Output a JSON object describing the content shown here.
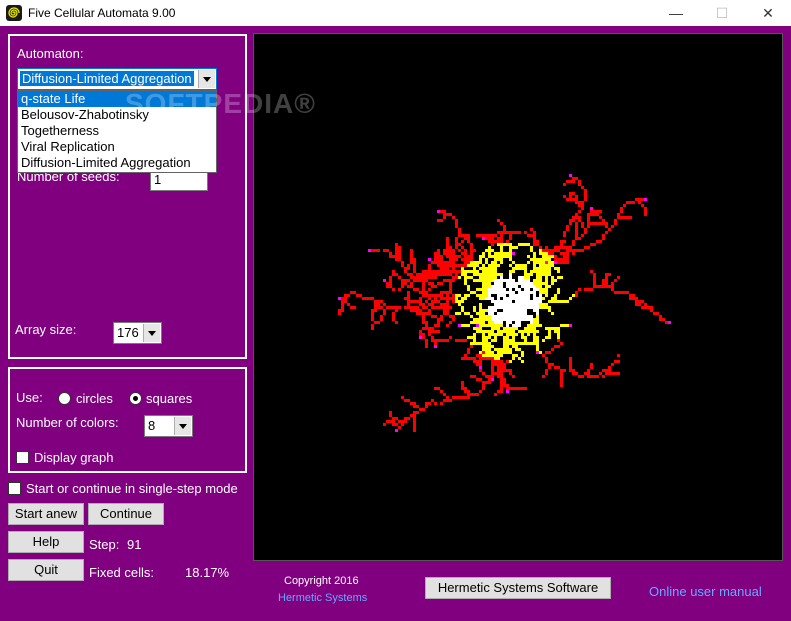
{
  "window": {
    "title": "Five Cellular Automata 9.00",
    "minimize": "—",
    "maximize": "☐",
    "close": "✕"
  },
  "watermark": "SOFTPEDIA®",
  "automaton": {
    "label": "Automaton:",
    "selected": "Diffusion-Limited Aggregation",
    "options": [
      "q-state Life",
      "Belousov-Zhabotinsky",
      "Togetherness",
      "Viral Replication",
      "Diffusion-Limited Aggregation"
    ],
    "highlighted": "q-state Life"
  },
  "seeds": {
    "label": "Number of seeds:",
    "value": "1"
  },
  "array": {
    "label": "Array size:",
    "value": "176"
  },
  "display": {
    "use_label": "Use:",
    "circles": "circles",
    "squares": "squares",
    "selected_shape": "squares",
    "colors_label": "Number of colors:",
    "colors_value": "8",
    "graph_label": "Display graph"
  },
  "single_step_label": "Start or continue in single-step mode",
  "buttons": {
    "start": "Start anew",
    "continue": "Continue",
    "help": "Help",
    "quit": "Quit",
    "hermetic": "Hermetic Systems Software"
  },
  "status": {
    "step_label": "Step:",
    "step_value": "91",
    "fixed_label": "Fixed cells:",
    "fixed_value": "18.17%"
  },
  "footer": {
    "copyright": "Copyright 2016",
    "company": "Hermetic Systems",
    "manual": "Online user manual"
  },
  "colors": {
    "background": "#800080",
    "white": "#ffffff",
    "yellow": "#ffff00",
    "red": "#ff0000",
    "magenta": "#ff00ff"
  }
}
